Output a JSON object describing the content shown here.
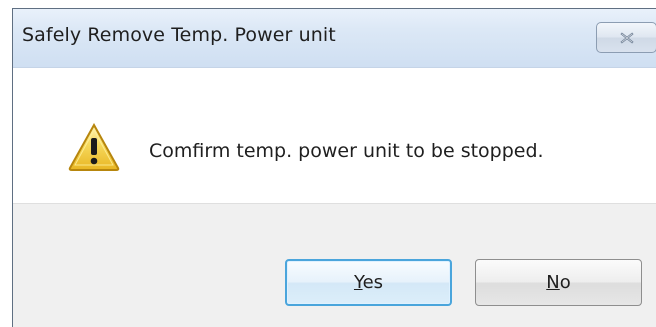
{
  "window": {
    "title": "Safely Remove Temp. Power unit"
  },
  "titlebar": {
    "close_icon": "close-icon"
  },
  "message": {
    "icon": "warning-icon",
    "text": "Comfirm temp. power unit to be stopped."
  },
  "buttons": {
    "yes": {
      "label": "Yes",
      "mnemonic": "Y",
      "rest": "es"
    },
    "no": {
      "label": "No",
      "mnemonic": "N",
      "rest": "o"
    }
  },
  "colors": {
    "title_bar": "#d8e5f5",
    "dialog_body": "#ffffff",
    "button_area": "#f0f0f0",
    "default_button_border": "#4aa5dc",
    "warning_fill": "#f2c94c"
  }
}
